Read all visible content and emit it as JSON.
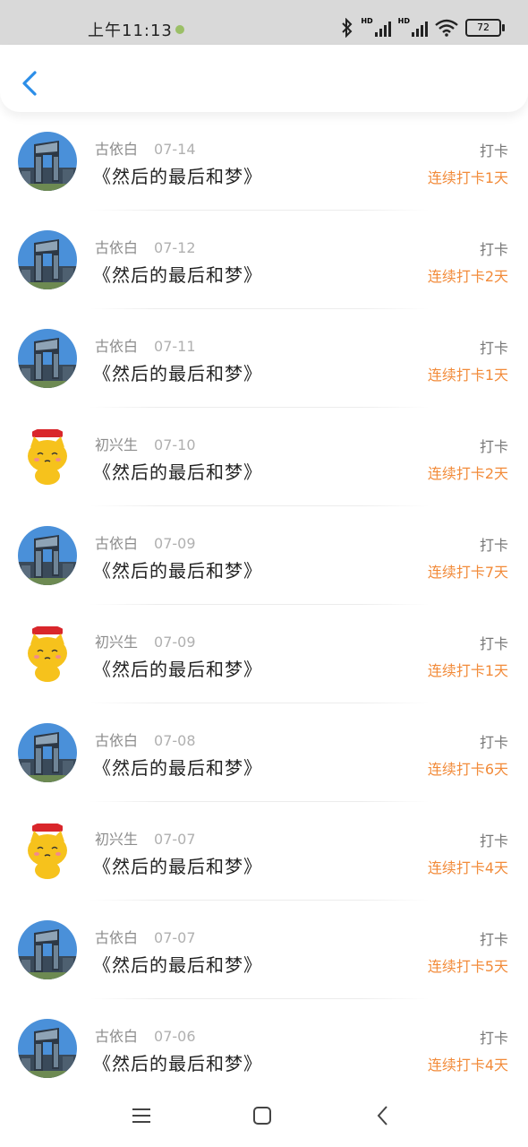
{
  "status_bar": {
    "time": "上午11:13",
    "battery": "72"
  },
  "colors": {
    "accent_blue": "#2b8ee8",
    "streak_orange": "#f28b3a"
  },
  "icons": {
    "back": "chevron-left-icon",
    "menu": "menu-icon",
    "home": "home-icon",
    "nav_back": "nav-back-icon"
  },
  "entries": [
    {
      "user": "古依白",
      "date": "07-14",
      "book": "《然后的最后和梦》",
      "action": "打卡",
      "streak": "连续打卡1天",
      "avatar": "building"
    },
    {
      "user": "古依白",
      "date": "07-12",
      "book": "《然后的最后和梦》",
      "action": "打卡",
      "streak": "连续打卡2天",
      "avatar": "building"
    },
    {
      "user": "古依白",
      "date": "07-11",
      "book": "《然后的最后和梦》",
      "action": "打卡",
      "streak": "连续打卡1天",
      "avatar": "building"
    },
    {
      "user": "初兴生",
      "date": "07-10",
      "book": "《然后的最后和梦》",
      "action": "打卡",
      "streak": "连续打卡2天",
      "avatar": "cat"
    },
    {
      "user": "古依白",
      "date": "07-09",
      "book": "《然后的最后和梦》",
      "action": "打卡",
      "streak": "连续打卡7天",
      "avatar": "building"
    },
    {
      "user": "初兴生",
      "date": "07-09",
      "book": "《然后的最后和梦》",
      "action": "打卡",
      "streak": "连续打卡1天",
      "avatar": "cat"
    },
    {
      "user": "古依白",
      "date": "07-08",
      "book": "《然后的最后和梦》",
      "action": "打卡",
      "streak": "连续打卡6天",
      "avatar": "building"
    },
    {
      "user": "初兴生",
      "date": "07-07",
      "book": "《然后的最后和梦》",
      "action": "打卡",
      "streak": "连续打卡4天",
      "avatar": "cat"
    },
    {
      "user": "古依白",
      "date": "07-07",
      "book": "《然后的最后和梦》",
      "action": "打卡",
      "streak": "连续打卡5天",
      "avatar": "building"
    },
    {
      "user": "古依白",
      "date": "07-06",
      "book": "《然后的最后和梦》",
      "action": "打卡",
      "streak": "连续打卡4天",
      "avatar": "building"
    }
  ]
}
